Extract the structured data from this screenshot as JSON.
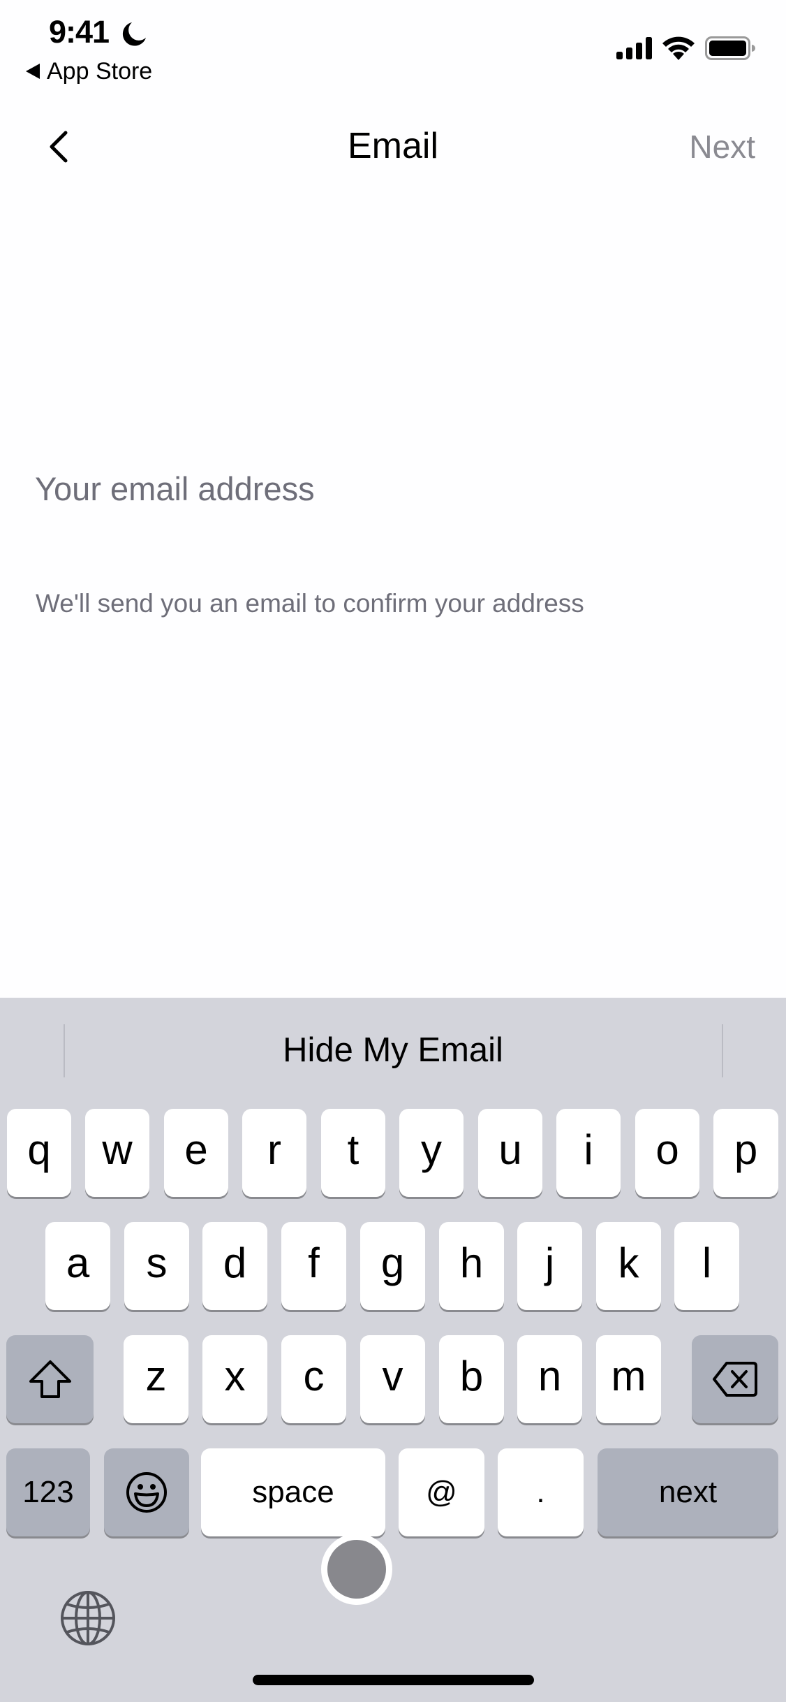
{
  "status_bar": {
    "time": "9:41",
    "focus_icon": "moon-icon",
    "back_app_label": "App Store",
    "icons": [
      "cellular-signal-icon",
      "wifi-icon",
      "battery-icon"
    ]
  },
  "nav": {
    "back_icon": "chevron-left-icon",
    "title": "Email",
    "next_label": "Next",
    "next_color": "#8a8a91"
  },
  "form": {
    "email_value": "",
    "email_placeholder": "Your email address",
    "hint": "We'll send you an email to confirm your address"
  },
  "keyboard": {
    "suggestion": "Hide My Email",
    "rows": [
      [
        "q",
        "w",
        "e",
        "r",
        "t",
        "y",
        "u",
        "i",
        "o",
        "p"
      ],
      [
        "a",
        "s",
        "d",
        "f",
        "g",
        "h",
        "j",
        "k",
        "l"
      ],
      [
        "z",
        "x",
        "c",
        "v",
        "b",
        "n",
        "m"
      ]
    ],
    "shift_icon": "shift-icon",
    "delete_icon": "backspace-icon",
    "numbers_label": "123",
    "emoji_icon": "emoji-icon",
    "space_label": "space",
    "at_label": "@",
    "period_label": ".",
    "return_label": "next",
    "globe_icon": "globe-icon",
    "background_color": "#d3d4db",
    "key_color": "#ffffff",
    "function_key_color": "#adb1bc"
  }
}
